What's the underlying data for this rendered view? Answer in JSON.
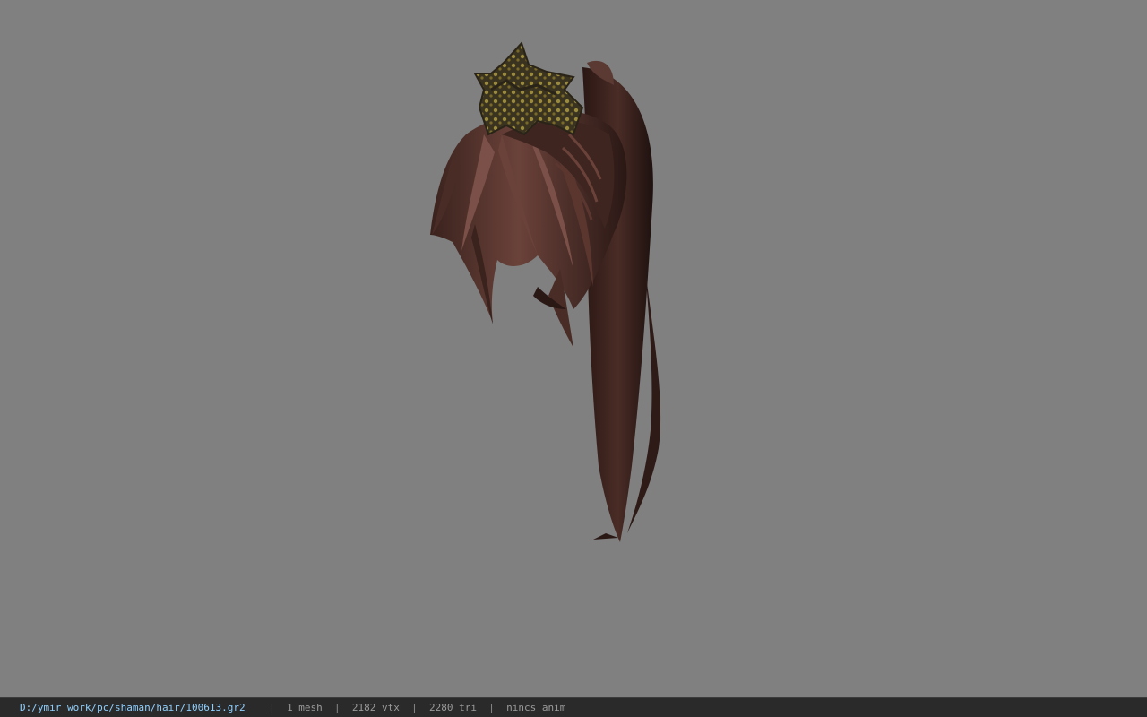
{
  "status_bar": {
    "file_path": "D:/ymir work/pc/shaman/hair/100613.gr2",
    "mesh_count": "1 mesh",
    "vertex_count": "2182 vtx",
    "triangle_count": "2280 tri",
    "animation": "nincs anim",
    "separator": "|"
  },
  "viewport": {
    "background_color": "#808080",
    "model": "hair-model"
  },
  "colors": {
    "path_text": "#8fd0ff",
    "status_text": "#9a9a9a",
    "hair_dark": "#2a1815",
    "hair_mid": "#4a2c26",
    "hair_light": "#7a5048",
    "crown_gold": "#8a7a2a"
  }
}
